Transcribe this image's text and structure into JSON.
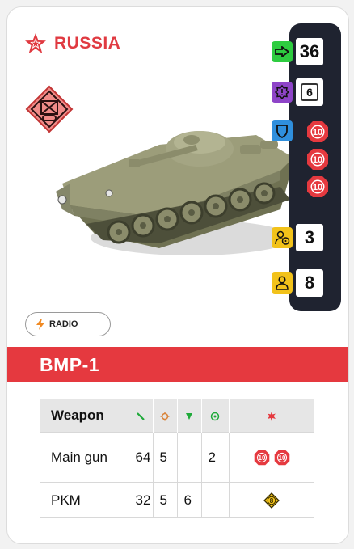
{
  "nation": {
    "name": "RUSSIA",
    "star_color": "#e03a41"
  },
  "unit": {
    "name": "BMP-1"
  },
  "stats": [
    {
      "key": "movement",
      "icon": "arrow-right-icon",
      "icon_bg": "#2ecc40",
      "value": "36"
    },
    {
      "key": "morale",
      "icon": "badge-exclamation-icon",
      "icon_bg": "#8e44c8",
      "value": "6"
    },
    {
      "key": "armor",
      "icon": "shield-icon",
      "icon_bg": "#2f8fdd",
      "values": [
        "10",
        "10",
        "10"
      ],
      "badge_color": "#e5393f"
    },
    {
      "key": "crew",
      "icon": "driver-wheel-icon",
      "icon_bg": "#f2c21a",
      "value": "3"
    },
    {
      "key": "passengers",
      "icon": "person-icon",
      "icon_bg": "#f2c21a",
      "value": "8"
    }
  ],
  "trait": {
    "label": "RADIO",
    "icon": "lightning-icon",
    "icon_color": "#f08a24"
  },
  "weapons": {
    "header": "Weapon",
    "rows": [
      {
        "name": "Main gun",
        "range": "64",
        "rof": "5",
        "ap": "",
        "accuracy": "2",
        "damage": [
          "10",
          "10"
        ],
        "damage_type": "red-hex"
      },
      {
        "name": "PKM",
        "range": "32",
        "rof": "5",
        "ap": "6",
        "accuracy": "",
        "damage": [
          "8"
        ],
        "damage_type": "yellow-diamond"
      }
    ]
  }
}
